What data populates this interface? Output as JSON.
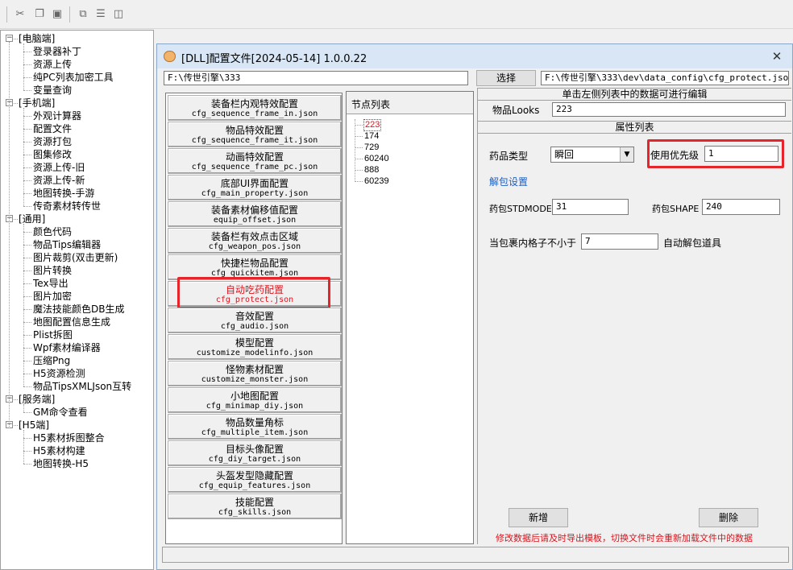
{
  "toolbar": {
    "icons": [
      "cut-icon",
      "copy-icon",
      "paste-icon",
      "cascade-icon",
      "tile-horizontal-icon",
      "tile-vertical-icon"
    ]
  },
  "tree": {
    "groups": [
      {
        "label": "[电脑端]",
        "items": [
          "登录器补丁",
          "资源上传",
          "纯PC列表加密工具",
          "变量查询"
        ]
      },
      {
        "label": "[手机端]",
        "items": [
          "外观计算器",
          "配置文件",
          "资源打包",
          "图集修改",
          "资源上传-旧",
          "资源上传-新",
          "地图转换-手游",
          "传奇素材转传世"
        ]
      },
      {
        "label": "[通用]",
        "items": [
          "颜色代码",
          "物品Tips编辑器",
          "图片裁剪(双击更新)",
          "图片转换",
          "Tex导出",
          "图片加密",
          "魔法技能颜色DB生成",
          "地图配置信息生成",
          "Plist拆图",
          "Wpf素材编译器",
          "压缩Png",
          "H5资源检测",
          "物品TipsXMLJson互转"
        ]
      },
      {
        "label": "[服务端]",
        "items": [
          "GM命令查看"
        ]
      },
      {
        "label": "[H5端]",
        "items": [
          "H5素材拆图整合",
          "H5素材构建",
          "地图转换-H5"
        ]
      }
    ]
  },
  "window": {
    "title": "[DLL]配置文件[2024-05-14] 1.0.0.22",
    "close_glyph": "✕"
  },
  "path_left": "F:\\传世引擎\\333",
  "select_button": "选择",
  "path_right": "F:\\传世引擎\\333\\dev\\data_config\\cfg_protect.json",
  "configs": [
    {
      "name": "装备栏内观特效配置",
      "file": "cfg_sequence_frame_in.json"
    },
    {
      "name": "物品特效配置",
      "file": "cfg_sequence_frame_it.json"
    },
    {
      "name": "动画特效配置",
      "file": "cfg_sequence_frame_pc.json"
    },
    {
      "name": "底部UI界面配置",
      "file": "cfg_main_property.json"
    },
    {
      "name": "装备素材偏移值配置",
      "file": "equip_offset.json"
    },
    {
      "name": "装备栏有效点击区域",
      "file": "cfg_weapon_pos.json"
    },
    {
      "name": "快捷栏物品配置",
      "file": "cfg_quickitem.json"
    },
    {
      "name": "自动吃药配置",
      "file": "cfg_protect.json",
      "selected": true
    },
    {
      "name": "音效配置",
      "file": "cfg_audio.json"
    },
    {
      "name": "模型配置",
      "file": "customize_modelinfo.json"
    },
    {
      "name": "怪物素材配置",
      "file": "customize_monster.json"
    },
    {
      "name": "小地图配置",
      "file": "cfg_minimap_diy.json"
    },
    {
      "name": "物品数量角标",
      "file": "cfg_multiple_item.json"
    },
    {
      "name": "目标头像配置",
      "file": "cfg_diy_target.json"
    },
    {
      "name": "头盔发型隐藏配置",
      "file": "cfg_equip_features.json"
    },
    {
      "name": "技能配置",
      "file": "cfg_skills.json"
    }
  ],
  "node_list": {
    "header": "节点列表",
    "items": [
      "223",
      "174",
      "729",
      "60240",
      "888",
      "60239"
    ],
    "selected_index": 0
  },
  "editor": {
    "hint": "单击左侧列表中的数据可进行编辑",
    "looks_label": "物品Looks",
    "looks_value": "223",
    "attr_title": "属性列表",
    "med_type_label": "药品类型",
    "med_type_value": "瞬回",
    "priority_label": "使用优先级",
    "priority_value": "1",
    "unpack_link": "解包设置",
    "stdmode_label": "药包STDMODE",
    "stdmode_value": "31",
    "shape_label": "药包SHAPE",
    "shape_value": "240",
    "slots_label": "当包裹内格子不小于",
    "slots_value": "7",
    "auto_unpack_label": "自动解包道具",
    "add_button": "新增",
    "delete_button": "删除",
    "warning": "修改数据后请及时导出模板，切换文件时会重新加载文件中的数据"
  },
  "colors": {
    "highlight": "#e5252a",
    "selected_text": "#e0141e",
    "link": "#1a5fc7",
    "warning": "#d8141c"
  }
}
